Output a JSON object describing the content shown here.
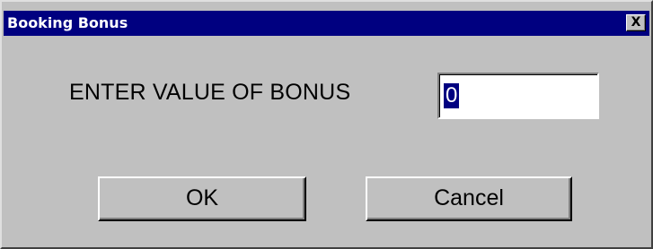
{
  "window": {
    "title": "Booking Bonus",
    "close_label": "X"
  },
  "form": {
    "prompt": "ENTER VALUE OF BONUS",
    "bonus_value": "0"
  },
  "buttons": {
    "ok_label": "OK",
    "cancel_label": "Cancel"
  },
  "colors": {
    "titlebar": "#000080",
    "face": "#c0c0c0",
    "selection": "#000080"
  }
}
